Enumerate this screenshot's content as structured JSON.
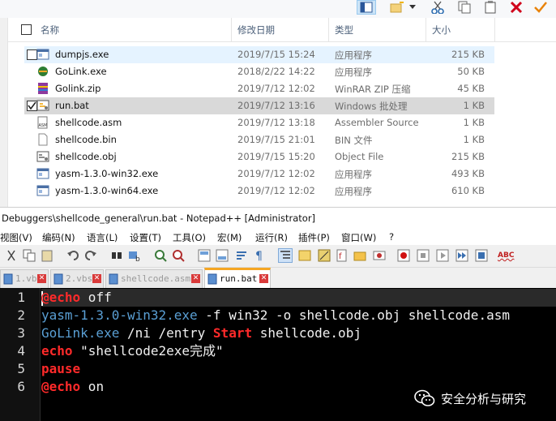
{
  "explorer": {
    "columns": {
      "name": "名称",
      "date": "修改日期",
      "type": "类型",
      "size": "大小"
    },
    "files": [
      {
        "name": "dumpjs.exe",
        "date": "2019/7/15 15:24",
        "type": "应用程序",
        "size": "215 KB",
        "icon": "exe-window-icon",
        "state": "hover",
        "checked": false
      },
      {
        "name": "GoLink.exe",
        "date": "2018/2/22 14:22",
        "type": "应用程序",
        "size": "50 KB",
        "icon": "golink-app-icon",
        "state": "",
        "checked": false
      },
      {
        "name": "Golink.zip",
        "date": "2019/7/12 12:02",
        "type": "WinRAR ZIP 压缩",
        "size": "45 KB",
        "icon": "winrar-archive-icon",
        "state": "",
        "checked": false
      },
      {
        "name": "run.bat",
        "date": "2019/7/12 13:16",
        "type": "Windows 批处理",
        "size": "1 KB",
        "icon": "batch-file-icon",
        "state": "selected",
        "checked": true
      },
      {
        "name": "shellcode.asm",
        "date": "2019/7/12 13:18",
        "type": "Assembler Source",
        "size": "1 KB",
        "icon": "asm-file-icon",
        "state": "",
        "checked": false
      },
      {
        "name": "shellcode.bin",
        "date": "2019/7/15 21:01",
        "type": "BIN 文件",
        "size": "1 KB",
        "icon": "blank-file-icon",
        "state": "",
        "checked": false
      },
      {
        "name": "shellcode.obj",
        "date": "2019/7/15 15:20",
        "type": "Object File",
        "size": "215 KB",
        "icon": "object-file-icon",
        "state": "",
        "checked": false
      },
      {
        "name": "yasm-1.3.0-win32.exe",
        "date": "2019/7/12 12:02",
        "type": "应用程序",
        "size": "493 KB",
        "icon": "exe-window-icon",
        "state": "",
        "checked": false
      },
      {
        "name": "yasm-1.3.0-win64.exe",
        "date": "2019/7/12 12:02",
        "type": "应用程序",
        "size": "610 KB",
        "icon": "exe-window-icon",
        "state": "",
        "checked": false
      }
    ]
  },
  "notepad": {
    "title": "Debuggers\\shellcode_general\\run.bat - Notepad++ [Administrator]",
    "menu": [
      "视图(V)",
      "编码(N)",
      "语言(L)",
      "设置(T)",
      "工具(O)",
      "宏(M)",
      "运行(R)",
      "插件(P)",
      "窗口(W)",
      "?"
    ],
    "tabs": [
      {
        "label": "1.vbs",
        "active": false
      },
      {
        "label": "2.vbs",
        "active": false
      },
      {
        "label": "shellcode.asm",
        "active": false
      },
      {
        "label": "run.bat",
        "active": true
      }
    ],
    "line_numbers": [
      "1",
      "2",
      "3",
      "4",
      "5",
      "6"
    ],
    "code": {
      "l1_kw": "@echo",
      "l1_rest": " off",
      "l2_cmd": "yasm-1.3.0-win32.exe",
      "l2_rest": " -f win32 -o shellcode.obj shellcode.asm",
      "l3_cmd": "GoLink.exe",
      "l3_mid": " /ni /entry ",
      "l3_kw": "Start",
      "l3_rest": " shellcode.obj",
      "l4_kw": "echo",
      "l4_rest": " \"shellcode2exe完成\"",
      "l5_kw": "pause",
      "l6_kw": "@echo",
      "l6_rest": " on"
    },
    "spellcheck_label": "ABC"
  },
  "watermark": {
    "text": "安全分析与研究"
  },
  "colors": {
    "hover_row": "#e5f3ff",
    "selected_row": "#d9d9d9",
    "editor_bg": "#000000",
    "keyword": "#ff2a2a",
    "command": "#5a9fd4",
    "active_tab_accent": "#f5a623"
  }
}
